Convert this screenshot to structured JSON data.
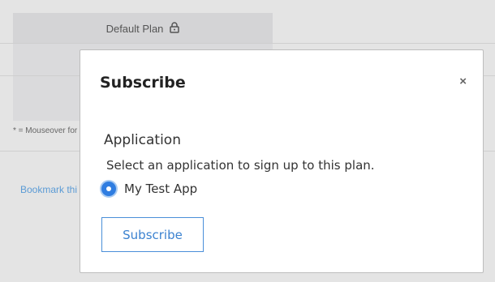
{
  "background": {
    "plan_header_label": "Default Plan",
    "plan_header_icon": "lock-icon",
    "footnote": "* = Mouseover for",
    "bookmark_link": "Bookmark thi"
  },
  "modal": {
    "title": "Subscribe",
    "close_glyph": "×",
    "section_heading": "Application",
    "instruction": "Select an application to sign up to this plan.",
    "radio_options": [
      {
        "label": "My Test App",
        "selected": true
      }
    ],
    "subscribe_button_label": "Subscribe"
  },
  "colors": {
    "accent": "#2f7de1",
    "button_border": "#4a8fd9",
    "link": "#5b9bd5",
    "backdrop": "#e4e4e4"
  }
}
